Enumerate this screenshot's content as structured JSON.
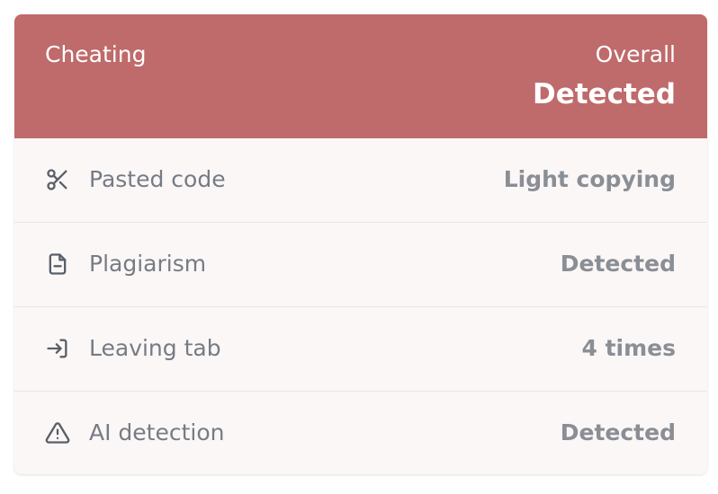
{
  "header": {
    "title": "Cheating",
    "overall_label": "Overall",
    "overall_value": "Detected",
    "color": "#bf6a6b"
  },
  "rows": [
    {
      "icon": "scissors-icon",
      "label": "Pasted code",
      "value": "Light copying"
    },
    {
      "icon": "document-minus-icon",
      "label": "Plagiarism",
      "value": "Detected"
    },
    {
      "icon": "exit-arrow-icon",
      "label": "Leaving tab",
      "value": "4 times"
    },
    {
      "icon": "warning-triangle-icon",
      "label": "AI detection",
      "value": "Detected"
    }
  ]
}
